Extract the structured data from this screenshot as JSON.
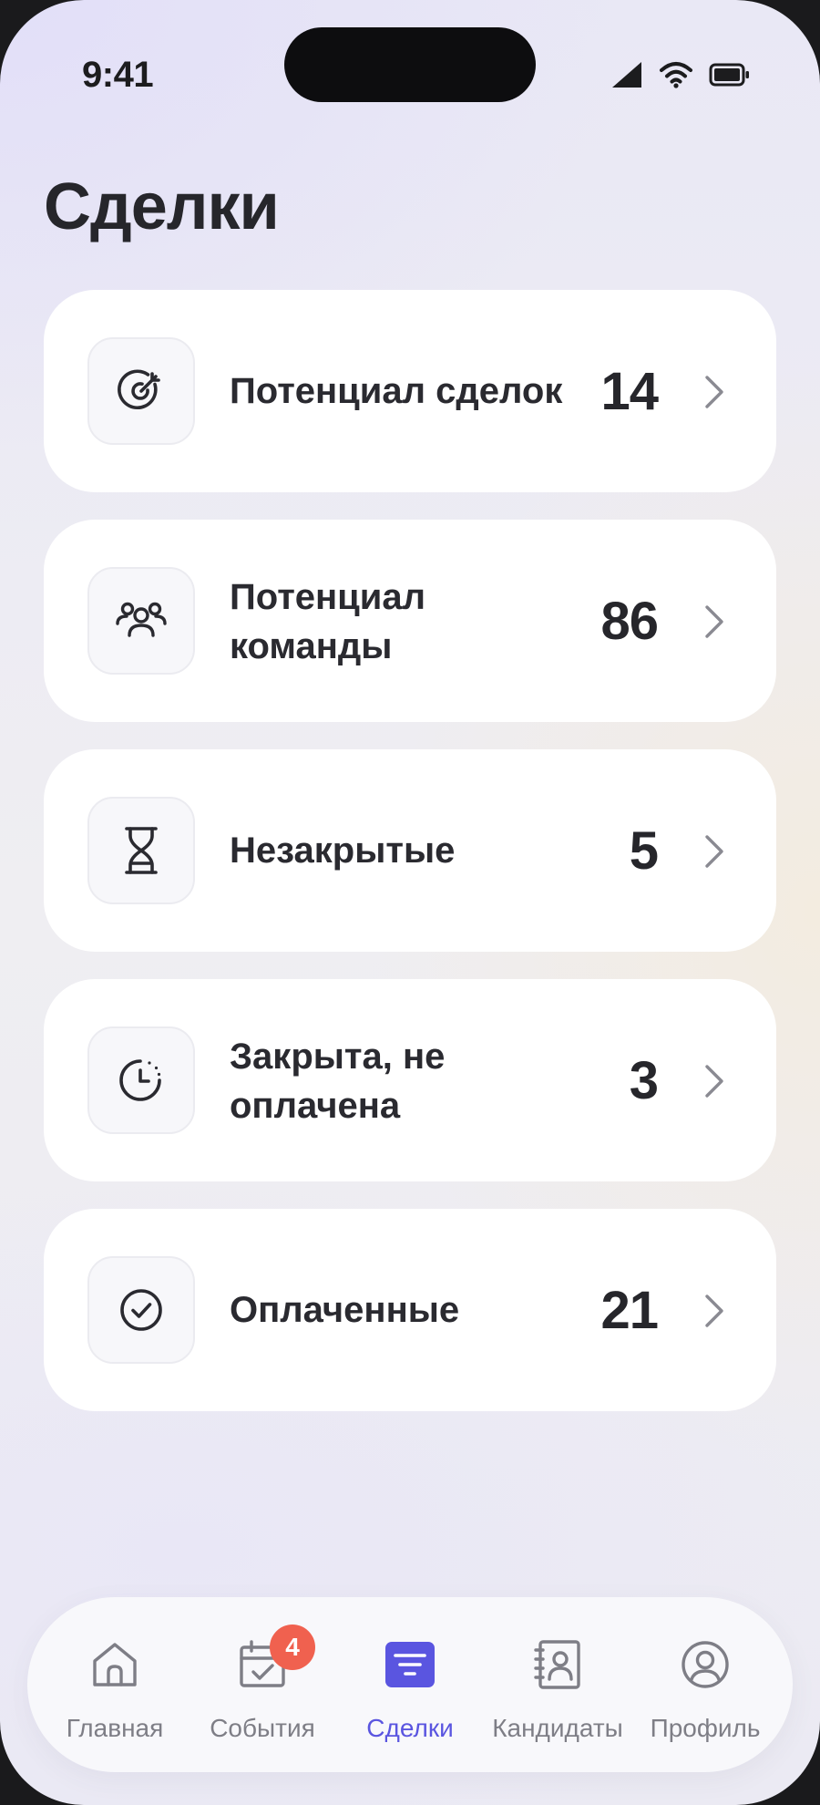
{
  "status_bar": {
    "time": "9:41"
  },
  "page": {
    "title": "Сделки"
  },
  "cards": [
    {
      "label": "Потенциал сделок",
      "count": "14",
      "icon": "target-icon"
    },
    {
      "label": "Потенциал команды",
      "count": "86",
      "icon": "team-icon"
    },
    {
      "label": "Незакрытые",
      "count": "5",
      "icon": "hourglass-icon"
    },
    {
      "label": "Закрыта, не оплачена",
      "count": "3",
      "icon": "clock-pending-icon"
    },
    {
      "label": "Оплаченные",
      "count": "21",
      "icon": "check-circle-icon"
    }
  ],
  "tabbar": {
    "items": [
      {
        "label": "Главная",
        "icon": "home-icon",
        "active": false
      },
      {
        "label": "События",
        "icon": "calendar-check-icon",
        "active": false,
        "badge": "4"
      },
      {
        "label": "Сделки",
        "icon": "filter-list-icon",
        "active": true
      },
      {
        "label": "Кандидаты",
        "icon": "contacts-book-icon",
        "active": false
      },
      {
        "label": "Профиль",
        "icon": "user-circle-icon",
        "active": false
      }
    ]
  },
  "colors": {
    "accent": "#5a55e0",
    "badge": "#f0614f",
    "card": "#ffffff"
  }
}
